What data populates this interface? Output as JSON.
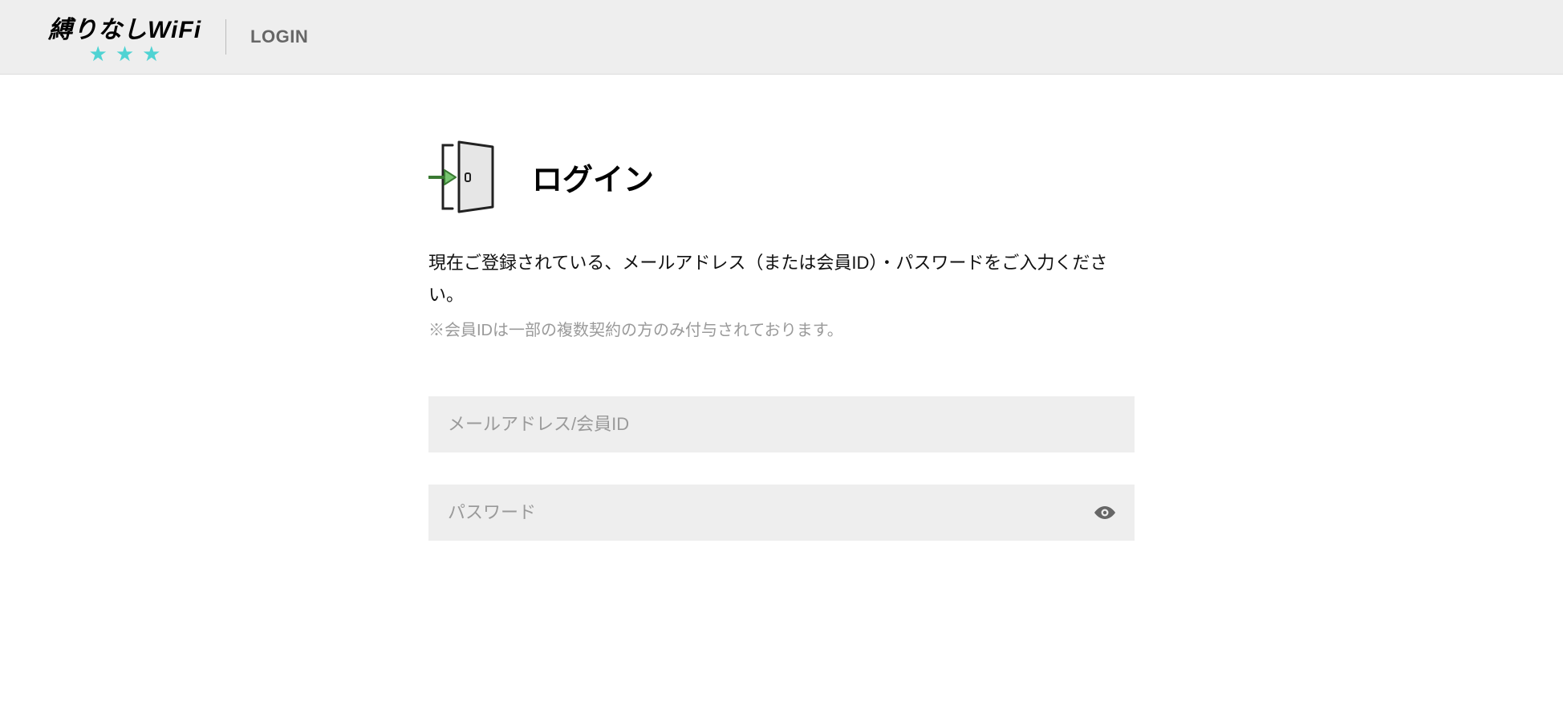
{
  "header": {
    "logo_text": "縛りなしWiFi",
    "login_label": "LOGIN"
  },
  "page": {
    "title": "ログイン",
    "description": "現在ご登録されている、メールアドレス（または会員ID）・パスワードをご入力ください。",
    "note": "※会員IDは一部の複数契約の方のみ付与されております。"
  },
  "form": {
    "email_placeholder": "メールアドレス/会員ID",
    "password_placeholder": "パスワード"
  }
}
